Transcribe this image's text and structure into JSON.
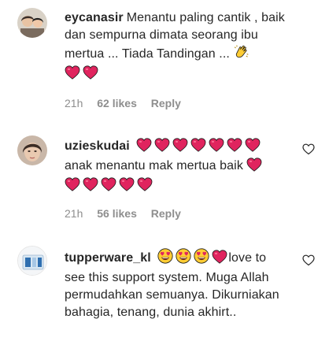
{
  "comments": [
    {
      "username": "eycanasir",
      "text": "Menantu paling cantik , baik dan sempurna dimata seorang ibu mertua ... Tiada Tandingan ...",
      "trailing_emojis": [
        "clap-emoji",
        "heart-emoji",
        "heart-emoji"
      ],
      "time": "21h",
      "likes": "62 likes",
      "reply": "Reply"
    },
    {
      "username": "uzieskudai",
      "inline_emojis": [
        "heart-emoji",
        "heart-emoji",
        "heart-emoji",
        "heart-emoji",
        "heart-emoji",
        "heart-emoji",
        "heart-emoji"
      ],
      "text": "anak menantu mak mertua baik",
      "trailing_emojis": [
        "heart-emoji",
        "heart-emoji",
        "heart-emoji",
        "heart-emoji",
        "heart-emoji",
        "heart-emoji"
      ],
      "time": "21h",
      "likes": "56 likes",
      "reply": "Reply"
    },
    {
      "username": "tupperware_kl",
      "inline_emojis": [
        "heart-eyes-emoji",
        "heart-eyes-emoji",
        "heart-eyes-emoji",
        "heart-emoji"
      ],
      "text_line1": "love to",
      "text_rest": "see this support system. Muga Allah permudahkan semuanya. Dikurniakan bahagia, tenang, dunia akhirt.."
    }
  ],
  "colors": {
    "heart": "#e0245e",
    "muted": "#8e8e8e",
    "text": "#262626"
  }
}
